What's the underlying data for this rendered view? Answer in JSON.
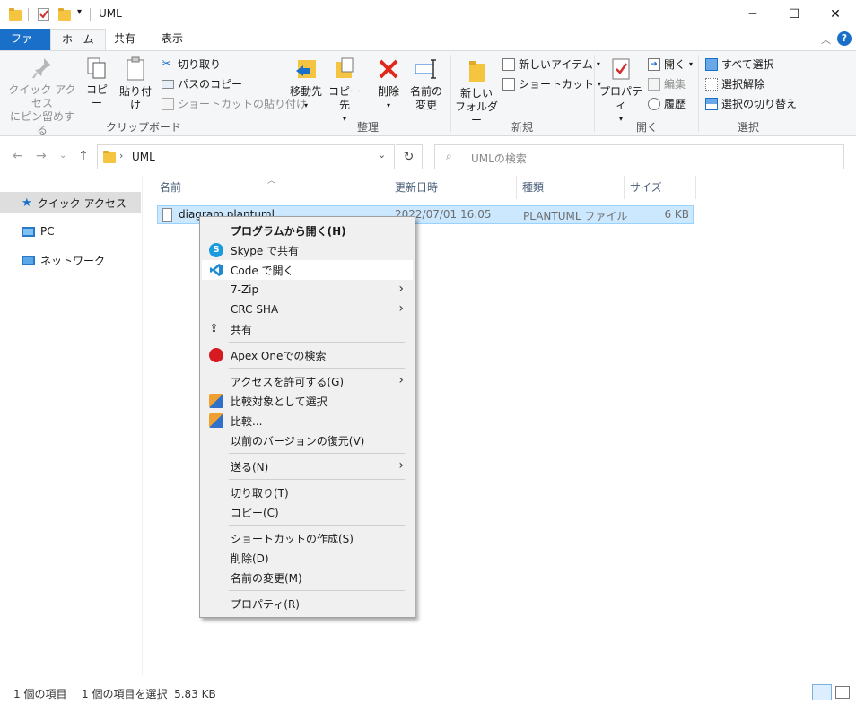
{
  "titlebar": {
    "title": "UML",
    "controls": {
      "minimize": "─",
      "maximize": "☐",
      "close": "✕"
    }
  },
  "ribbon_tabs": [
    {
      "label": "ファイル"
    },
    {
      "label": "ホーム"
    },
    {
      "label": "共有"
    },
    {
      "label": "表示"
    }
  ],
  "ribbon": {
    "clipboard": {
      "pin_line1": "クイック アクセス",
      "pin_line2": "にピン留めする",
      "copy": "コピー",
      "paste": "貼り付け",
      "cut": "切り取り",
      "copy_path": "パスのコピー",
      "paste_shortcut": "ショートカットの貼り付け",
      "group": "クリップボード"
    },
    "organize": {
      "move_to": "移動先",
      "copy_to": "コピー先",
      "delete": "削除",
      "rename_line1": "名前の",
      "rename_line2": "変更",
      "group": "整理"
    },
    "new": {
      "new_folder_line1": "新しい",
      "new_folder_line2": "フォルダー",
      "new_item": "新しいアイテム",
      "shortcut": "ショートカット",
      "group": "新規"
    },
    "open": {
      "properties": "プロパティ",
      "open": "開く",
      "edit": "編集",
      "history": "履歴",
      "group": "開く"
    },
    "select": {
      "select_all": "すべて選択",
      "select_none": "選択解除",
      "invert": "選択の切り替え",
      "group": "選択"
    }
  },
  "address": {
    "path": "UML",
    "search_placeholder": "UMLの検索"
  },
  "nav_pane": [
    {
      "label": "クイック アクセス",
      "icon": "star-icon"
    },
    {
      "label": "PC",
      "icon": "pc-icon"
    },
    {
      "label": "ネットワーク",
      "icon": "network-icon"
    }
  ],
  "columns": {
    "name": "名前",
    "modified": "更新日時",
    "type": "種類",
    "size": "サイズ"
  },
  "files": [
    {
      "name": "diagram.plantuml",
      "modified": "2022/07/01 16:05",
      "type": "PLANTUML ファイル",
      "size": "6 KB"
    }
  ],
  "context_menu": {
    "open_with": "プログラムから開く(H)",
    "skype_share": "Skype で共有",
    "code_open": "Code で開く",
    "zip": "7-Zip",
    "crc": "CRC SHA",
    "share": "共有",
    "apex": "Apex Oneでの検索",
    "grant_access": "アクセスを許可する(G)",
    "select_compare": "比較対象として選択",
    "compare": "比較...",
    "restore": "以前のバージョンの復元(V)",
    "send_to": "送る(N)",
    "cut": "切り取り(T)",
    "copy": "コピー(C)",
    "create_shortcut": "ショートカットの作成(S)",
    "delete": "削除(D)",
    "rename": "名前の変更(M)",
    "properties": "プロパティ(R)"
  },
  "status": {
    "items": "1 個の項目",
    "selected": "1 個の項目を選択  5.83 KB"
  },
  "colors": {
    "accent": "#1a6fc9",
    "selection": "#cce8ff",
    "folder": "#f5c542"
  }
}
